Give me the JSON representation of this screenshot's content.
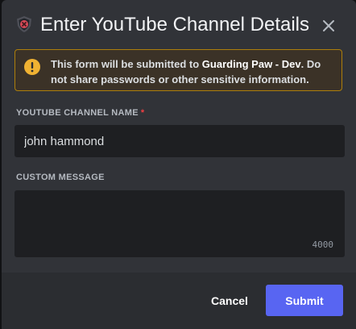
{
  "modal": {
    "title": "Enter YouTube Channel Details",
    "app_icon": "app-avatar-icon",
    "close_icon": "close-icon"
  },
  "warning": {
    "icon": "exclamation-icon",
    "text_before": "This form will be submitted to ",
    "app_name": "Guarding Paw - Dev",
    "text_after": ". Do not share passwords or other sensitive information."
  },
  "fields": {
    "channel_name": {
      "label": "YouTube Channel Name",
      "required_mark": "*",
      "value": "john hammond"
    },
    "custom_message": {
      "label": "Custom Message",
      "value": "",
      "char_count": "4000"
    }
  },
  "footer": {
    "cancel_label": "Cancel",
    "submit_label": "Submit"
  },
  "colors": {
    "accent": "#5865f2",
    "warning_border": "#ad7f0c",
    "warning_icon": "#f0b232",
    "required": "#f23f42"
  }
}
